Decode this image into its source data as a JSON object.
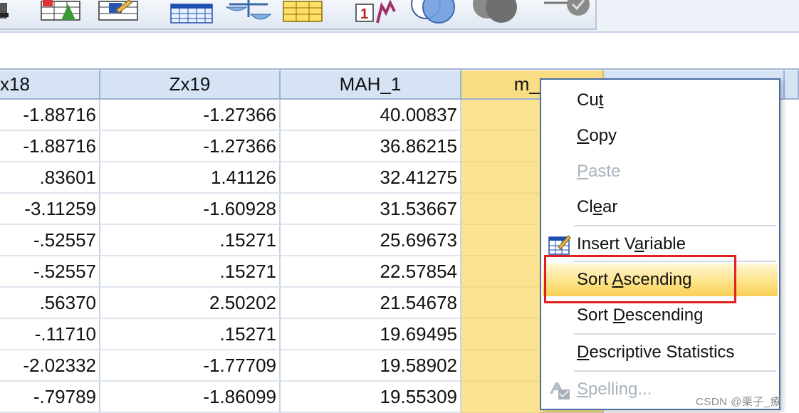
{
  "toolbar": {
    "buttons": [
      {
        "name": "partial-left-icon"
      },
      {
        "name": "split-file-icon"
      },
      {
        "name": "select-cases-icon"
      },
      {
        "name": "grid-table-icon"
      },
      {
        "name": "weight-cases-icon"
      },
      {
        "name": "value-labels-icon"
      },
      {
        "name": "insert-variable-icon",
        "label": "1"
      },
      {
        "name": "venn-circles-icon"
      },
      {
        "name": "use-sets-icon"
      },
      {
        "name": "show-all-icon"
      }
    ]
  },
  "grid": {
    "columns": [
      {
        "header": "x18",
        "values": [
          "-1.88716",
          "-1.88716",
          ".83601",
          "-3.11259",
          "-.52557",
          "-.52557",
          ".56370",
          "-.11710",
          "-2.02332",
          "-.79789"
        ]
      },
      {
        "header": "Zx19",
        "values": [
          "-1.27366",
          "-1.27366",
          "1.41126",
          "-1.60928",
          ".15271",
          ".15271",
          "2.50202",
          ".15271",
          "-1.77709",
          "-1.86099"
        ]
      },
      {
        "header": "MAH_1",
        "values": [
          "40.00837",
          "36.86215",
          "32.41275",
          "31.53667",
          "25.69673",
          "22.57854",
          "21.54678",
          "19.69495",
          "19.58902",
          "19.55309"
        ]
      },
      {
        "header": "m_p",
        "values": [
          "",
          "",
          "",
          "",
          "",
          "",
          "",
          "",
          "",
          ""
        ]
      }
    ]
  },
  "context_menu": {
    "cut": {
      "label": "Cut",
      "pre": "Cu",
      "key": "t",
      "post": ""
    },
    "copy": {
      "label": "Copy",
      "pre": "",
      "key": "C",
      "post": "opy"
    },
    "paste": {
      "label": "Paste",
      "pre": "",
      "key": "P",
      "post": "aste"
    },
    "clear": {
      "label": "Clear",
      "pre": "Cl",
      "key": "e",
      "post": "ar"
    },
    "insert_variable": {
      "label": "Insert Variable",
      "pre": "Insert V",
      "key": "a",
      "post": "riable"
    },
    "sort_ascending": {
      "label": "Sort Ascending",
      "pre": "Sort ",
      "key": "A",
      "post": "scending"
    },
    "sort_descending": {
      "label": "Sort Descending",
      "pre": "Sort ",
      "key": "D",
      "post": "escending"
    },
    "descriptive_statistics": {
      "label": "Descriptive Statistics",
      "pre": "",
      "key": "D",
      "post": "escriptive Statistics"
    },
    "spelling": {
      "label": "Spelling...",
      "pre": "",
      "key": "S",
      "post": "pelling..."
    }
  },
  "watermark": "CSDN @栗子_療",
  "colors": {
    "header_bg": "#d5e3f5",
    "selected_column": "#fbe392",
    "menu_highlight": "#fde38a",
    "annotation": "#e02020",
    "menu_border": "#4a6da8"
  }
}
